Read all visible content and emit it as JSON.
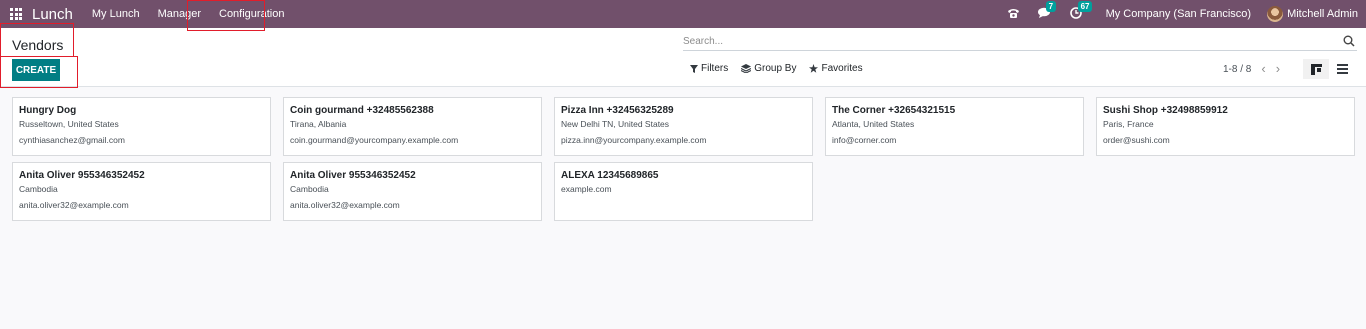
{
  "navbar": {
    "app_name": "Lunch",
    "menus": [
      "My Lunch",
      "Manager",
      "Configuration"
    ],
    "chat_badge": "7",
    "activity_badge": "67",
    "company": "My Company (San Francisco)",
    "user": "Mitchell Admin",
    "bg_color": "#71506b"
  },
  "control_panel": {
    "title": "Vendors",
    "create_label": "CREATE",
    "search_placeholder": "Search...",
    "filters_label": "Filters",
    "group_by_label": "Group By",
    "favorites_label": "Favorites",
    "pager": "1-8 / 8",
    "accent_color": "#017e84"
  },
  "vendors": [
    {
      "name": "Hungry Dog",
      "address": "Russeltown, United States",
      "email": "cynthiasanchez@gmail.com"
    },
    {
      "name": "Coin gourmand +32485562388",
      "address": "Tirana, Albania",
      "email": "coin.gourmand@yourcompany.example.com"
    },
    {
      "name": "Pizza Inn +32456325289",
      "address": "New Delhi TN, United States",
      "email": "pizza.inn@yourcompany.example.com"
    },
    {
      "name": "The Corner +32654321515",
      "address": "Atlanta, United States",
      "email": "info@corner.com"
    },
    {
      "name": "Sushi Shop +32498859912",
      "address": "Paris, France",
      "email": "order@sushi.com"
    },
    {
      "name": "Anita Oliver 955346352452",
      "address": "Cambodia",
      "email": "anita.oliver32@example.com"
    },
    {
      "name": "Anita Oliver 955346352452",
      "address": "Cambodia",
      "email": "anita.oliver32@example.com"
    },
    {
      "name": "ALEXA 12345689865",
      "address": "",
      "email": "example.com"
    }
  ]
}
